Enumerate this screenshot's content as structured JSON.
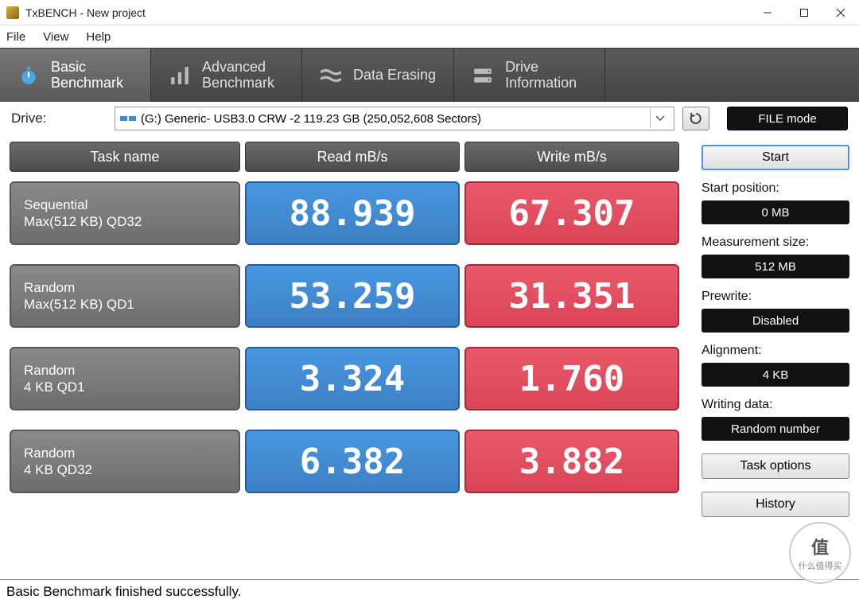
{
  "window": {
    "title": "TxBENCH - New project"
  },
  "menu": {
    "file": "File",
    "view": "View",
    "help": "Help"
  },
  "tabs": [
    {
      "label": "Basic\nBenchmark",
      "active": true
    },
    {
      "label": "Advanced\nBenchmark",
      "active": false
    },
    {
      "label": "Data Erasing",
      "active": false
    },
    {
      "label": "Drive\nInformation",
      "active": false
    }
  ],
  "drive": {
    "label": "Drive:",
    "selected": "(G:) Generic- USB3.0 CRW   -2  119.23 GB (250,052,608 Sectors)"
  },
  "file_mode_btn": "FILE mode",
  "headers": {
    "task": "Task name",
    "read": "Read mB/s",
    "write": "Write mB/s"
  },
  "rows": [
    {
      "name1": "Sequential",
      "name2": "Max(512 KB) QD32",
      "read": "88.939",
      "write": "67.307"
    },
    {
      "name1": "Random",
      "name2": "Max(512 KB) QD1",
      "read": "53.259",
      "write": "31.351"
    },
    {
      "name1": "Random",
      "name2": "4 KB QD1",
      "read": "3.324",
      "write": "1.760"
    },
    {
      "name1": "Random",
      "name2": "4 KB QD32",
      "read": "6.382",
      "write": "3.882"
    }
  ],
  "side": {
    "start": "Start",
    "start_position_label": "Start position:",
    "start_position": "0 MB",
    "measurement_size_label": "Measurement size:",
    "measurement_size": "512 MB",
    "prewrite_label": "Prewrite:",
    "prewrite": "Disabled",
    "alignment_label": "Alignment:",
    "alignment": "4 KB",
    "writing_data_label": "Writing data:",
    "writing_data": "Random number",
    "task_options": "Task options",
    "history": "History"
  },
  "status": "Basic Benchmark finished successfully.",
  "watermark": {
    "char": "值",
    "text": "什么值得买"
  }
}
